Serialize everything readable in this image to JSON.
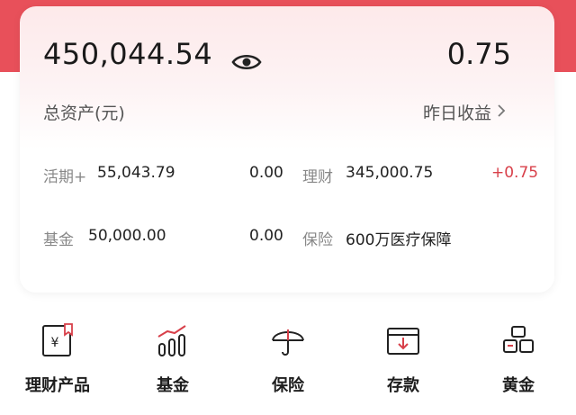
{
  "summary": {
    "total_assets": "450,044.54",
    "total_assets_label": "总资产(元)",
    "yesterday_earnings": "0.75",
    "yesterday_earnings_label": "昨日收益"
  },
  "accounts": {
    "current_label": "活期+",
    "current_value": "55,043.79",
    "current_change": "0.00",
    "wealth_label": "理财",
    "wealth_value": "345,000.75",
    "wealth_change": "+0.75",
    "fund_label": "基金",
    "fund_value": "50,000.00",
    "fund_change": "0.00",
    "insurance_label": "保险",
    "insurance_value": "600万医疗保障"
  },
  "categories": [
    {
      "label": "理财产品",
      "icon": "wealth-product-icon"
    },
    {
      "label": "基金",
      "icon": "fund-chart-icon"
    },
    {
      "label": "保险",
      "icon": "umbrella-icon"
    },
    {
      "label": "存款",
      "icon": "deposit-icon"
    },
    {
      "label": "黄金",
      "icon": "gold-bars-icon"
    }
  ],
  "colors": {
    "accent_red": "#e8505a",
    "positive_red": "#d8404a"
  }
}
